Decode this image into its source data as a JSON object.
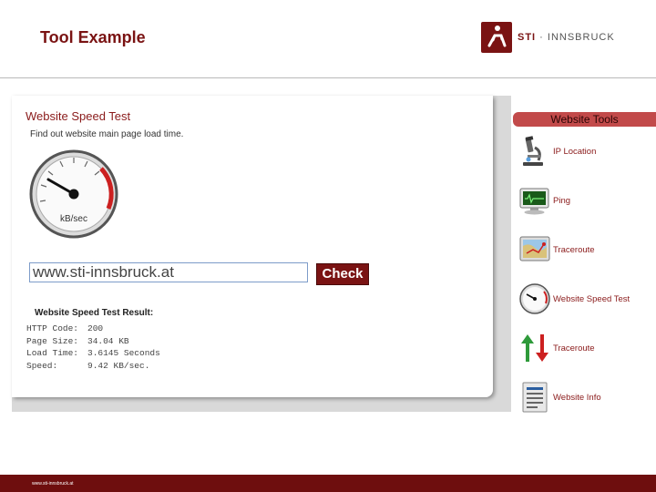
{
  "slide": {
    "title": "Tool Example",
    "footer_url": "www.sti-innsbruck.at"
  },
  "logo": {
    "bold": "STI",
    "rest": " · INNSBRUCK"
  },
  "speed_test": {
    "title": "Website Speed Test",
    "subtitle": "Find out website main page load time.",
    "gauge_label": "kB/sec",
    "url_value": "www.sti-innsbruck.at",
    "check_label": "Check",
    "result_title": "Website Speed Test Result:",
    "results": [
      {
        "key": "HTTP Code:",
        "value": "200"
      },
      {
        "key": "Page Size:",
        "value": "34.04 KB"
      },
      {
        "key": "Load Time:",
        "value": "3.6145 Seconds"
      },
      {
        "key": "Speed:",
        "value": "9.42 KB/sec."
      }
    ]
  },
  "tools": {
    "header": "Website Tools",
    "items": [
      {
        "label": "IP Location",
        "icon": "microscope-icon"
      },
      {
        "label": "Ping",
        "icon": "monitor-icon"
      },
      {
        "label": "Traceroute",
        "icon": "map-icon"
      },
      {
        "label": "Website Speed Test",
        "icon": "speedometer-icon"
      },
      {
        "label": "Traceroute",
        "icon": "up-down-arrows-icon"
      },
      {
        "label": "Website Info",
        "icon": "document-icon"
      }
    ]
  },
  "colors": {
    "brand": "#7a1313",
    "tools_header": "#c24a4a",
    "input_border": "#7d9cc9"
  }
}
